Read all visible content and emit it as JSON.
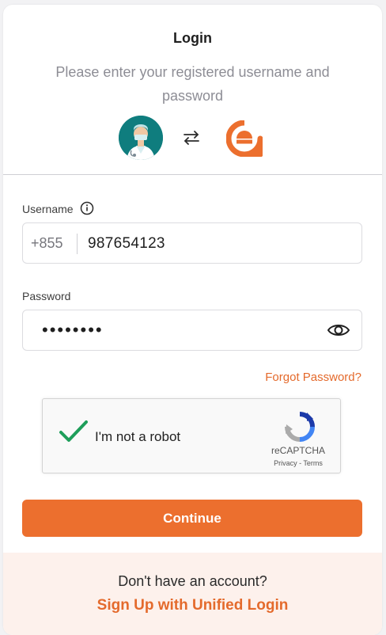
{
  "header": {
    "title": "Login",
    "subtitle": "Please enter your registered username and password"
  },
  "icons": {
    "doctor": "doctor-avatar-icon",
    "swap": "swap-arrows-icon",
    "brand": "brand-e-logo-icon",
    "info": "info-icon",
    "eye": "eye-icon",
    "check": "checkmark-icon",
    "recaptcha": "recaptcha-logo-icon"
  },
  "username": {
    "label": "Username",
    "prefix": "+855",
    "value": "987654123"
  },
  "password": {
    "label": "Password",
    "masked_value": "••••••••"
  },
  "links": {
    "forgot_password": "Forgot Password?"
  },
  "recaptcha": {
    "label": "I'm not a robot",
    "brand": "reCAPTCHA",
    "links": "Privacy - Terms",
    "checked": true
  },
  "actions": {
    "continue": "Continue"
  },
  "footer": {
    "prompt": "Don't have an account?",
    "signup": "Sign Up with Unified Login"
  },
  "colors": {
    "accent": "#EC6F2E",
    "footer_bg": "#FDF1EC",
    "avatar_bg": "#0F7D7E",
    "check_green": "#1E9E5A"
  }
}
